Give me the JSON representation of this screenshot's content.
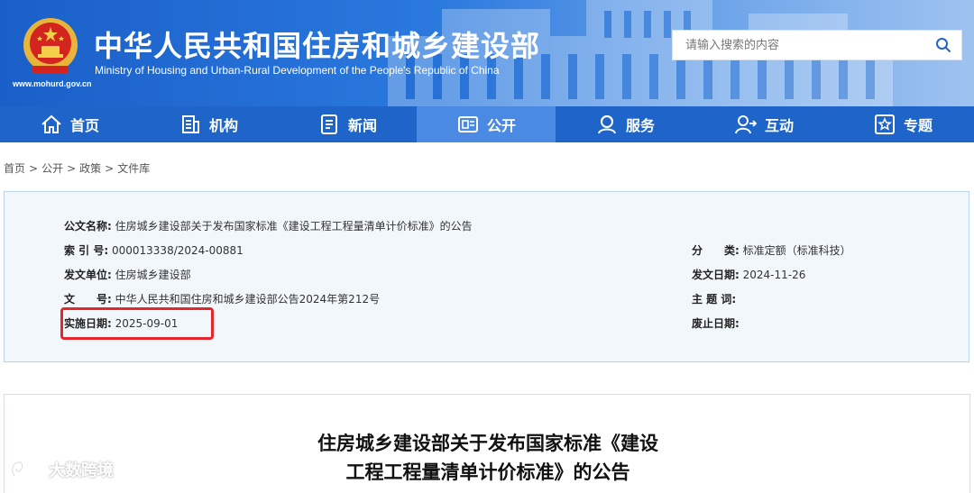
{
  "header": {
    "title_cn": "中华人民共和国住房和城乡建设部",
    "title_en": "Ministry of Housing and Urban-Rural Development of the People's Republic of China",
    "site_url": "www.mohurd.gov.cn",
    "emblem_icon": "national-emblem-icon",
    "search": {
      "placeholder": "请输入搜索的内容",
      "icon": "search-icon"
    }
  },
  "nav": {
    "items": [
      {
        "label": "首页",
        "icon": "home-icon"
      },
      {
        "label": "机构",
        "icon": "building-icon"
      },
      {
        "label": "新闻",
        "icon": "news-icon"
      },
      {
        "label": "公开",
        "icon": "disclosure-icon",
        "active": true
      },
      {
        "label": "服务",
        "icon": "service-icon"
      },
      {
        "label": "互动",
        "icon": "interaction-icon"
      },
      {
        "label": "专题",
        "icon": "topic-icon"
      }
    ]
  },
  "breadcrumb": {
    "items": [
      "首页",
      "公开",
      "政策",
      "文件库"
    ],
    "separator": ">"
  },
  "info": {
    "doc_name_label": "公文名称:",
    "doc_name_value": "住房城乡建设部关于发布国家标准《建设工程工程量清单计价标准》的公告",
    "index_label": "索 引 号:",
    "index_value": "000013338/2024-00881",
    "category_label": "分　　类:",
    "category_value": "标准定额（标准科技）",
    "issuer_label": "发文单位:",
    "issuer_value": "住房城乡建设部",
    "issue_date_label": "发文日期:",
    "issue_date_value": "2024-11-26",
    "doc_no_label": "文　　号:",
    "doc_no_value": "中华人民共和国住房和城乡建设部公告2024年第212号",
    "keywords_label": "主 题 词:",
    "keywords_value": "",
    "effective_label": "实施日期:",
    "effective_value": "2025-09-01",
    "repeal_label": "废止日期:",
    "repeal_value": "",
    "highlight_color": "#e5272d"
  },
  "article": {
    "title_line1": "住房城乡建设部关于发布国家标准《建设",
    "title_line2": "工程工程量清单计价标准》的公告"
  },
  "watermark": {
    "text": "大数跨境"
  },
  "colors": {
    "header_blue": "#1a5fc8",
    "nav_blue": "#1e64c9",
    "nav_active": "#4b8ae3",
    "info_bg": "#f2f7fc"
  }
}
